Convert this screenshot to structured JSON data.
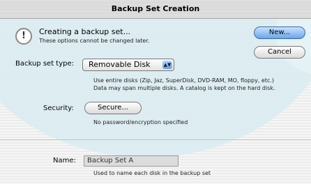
{
  "window": {
    "title": "Backup Set Creation"
  },
  "alert": {
    "icon": "alert-icon",
    "icon_glyph": "!",
    "title": "Creating a backup set...",
    "subtitle": "These options cannot be changed later."
  },
  "buttons": {
    "new_label": "New...",
    "cancel_label": "Cancel",
    "secure_label": "Secure..."
  },
  "backup_type": {
    "label": "Backup set type:",
    "selected": "Removable Disk",
    "arrow_glyph": "▲▼",
    "desc_line1": "Use entire disks (Zip, Jaz, SuperDisk, DVD-RAM, MO, floppy, etc.)",
    "desc_line2": "Data may span multiple disks. A catalog is kept on the hard disk."
  },
  "security": {
    "label": "Security:",
    "status": "No password/encryption specified"
  },
  "name": {
    "label": "Name:",
    "value": "Backup Set A",
    "hint": "Used to name each disk in the backup set"
  },
  "colors": {
    "default_button": "#6aa6ea",
    "backdrop": "#dcecf2"
  }
}
